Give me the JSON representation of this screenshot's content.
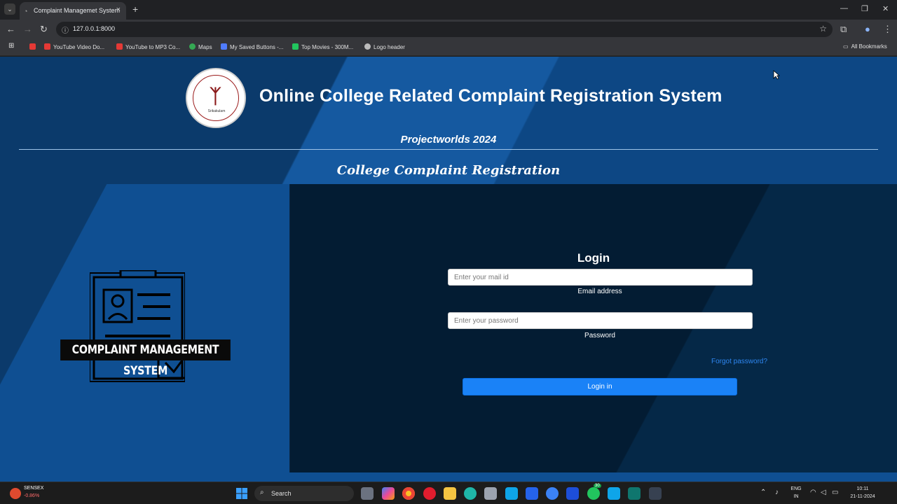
{
  "browser": {
    "tab_title": "Complaint Managemet System",
    "url": "127.0.0.1:8000",
    "bookmarks": [
      {
        "label": "YouTube Video Do...",
        "color": "#e53935"
      },
      {
        "label": "YouTube to MP3 Co...",
        "color": "#e53935"
      },
      {
        "label": "Maps",
        "color": "#34a853"
      },
      {
        "label": "My Saved Buttons -...",
        "color": "#4f7cff"
      },
      {
        "label": "Top Movies - 300M...",
        "color": "#22c55e"
      },
      {
        "label": "Logo header",
        "color": "#bbbbbb"
      }
    ],
    "all_bookmarks": "All Bookmarks"
  },
  "header": {
    "logo_text": "Srikakulam",
    "title": "Online College Related Complaint Registration System",
    "subtitle": "Projectworlds 2024",
    "section_title": "College Complaint Registration"
  },
  "left_panel": {
    "banner": "COMPLAINT MANAGEMENT SYSTEM"
  },
  "login": {
    "title": "Login",
    "email_placeholder": "Enter your mail id",
    "email_label": "Email address",
    "password_placeholder": "Enter your password",
    "password_label": "Password",
    "forgot": "Forgot password?",
    "submit": "Login in"
  },
  "taskbar": {
    "ticker_name": "SENSEX",
    "ticker_value": "-0.86%",
    "search": "Search",
    "whatsapp_badge": "30",
    "lang": "ENG",
    "region": "IN",
    "time": "10:11",
    "date": "21-11-2024"
  },
  "colors": {
    "accent": "#1a82f7",
    "header_bg": "#0d4784",
    "panel_dark": "#031c33"
  }
}
